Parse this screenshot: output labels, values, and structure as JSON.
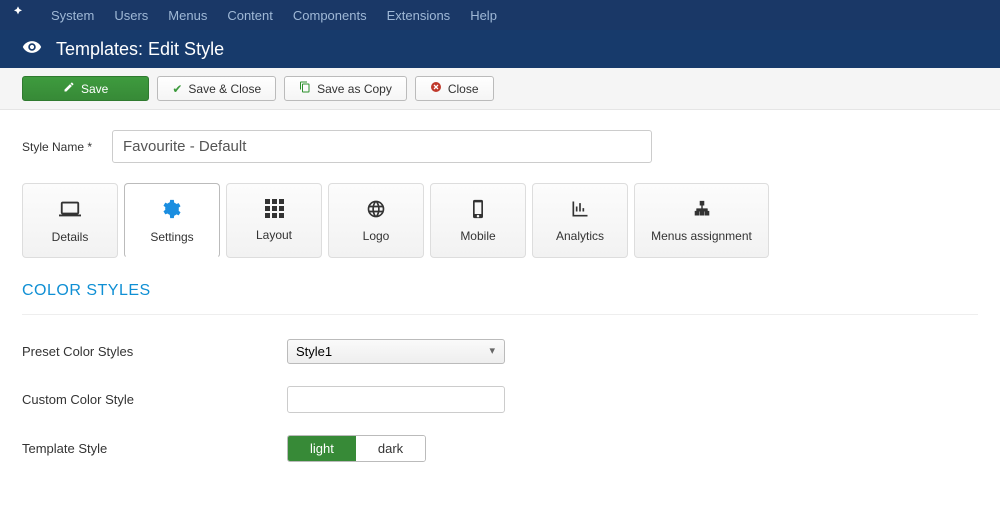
{
  "topmenu": {
    "items": [
      "System",
      "Users",
      "Menus",
      "Content",
      "Components",
      "Extensions",
      "Help"
    ]
  },
  "header": {
    "title": "Templates: Edit Style"
  },
  "toolbar": {
    "save": "Save",
    "save_close": "Save & Close",
    "save_copy": "Save as Copy",
    "close": "Close"
  },
  "form": {
    "style_name_label": "Style Name *",
    "style_name_value": "Favourite - Default"
  },
  "tabs": {
    "items": [
      {
        "label": "Details"
      },
      {
        "label": "Settings"
      },
      {
        "label": "Layout"
      },
      {
        "label": "Logo"
      },
      {
        "label": "Mobile"
      },
      {
        "label": "Analytics"
      },
      {
        "label": "Menus assignment"
      }
    ]
  },
  "section": {
    "title": "COLOR STYLES"
  },
  "fields": {
    "preset_label": "Preset Color Styles",
    "preset_value": "Style1",
    "custom_label": "Custom Color Style",
    "custom_value": "",
    "template_label": "Template Style",
    "template_light": "light",
    "template_dark": "dark"
  }
}
